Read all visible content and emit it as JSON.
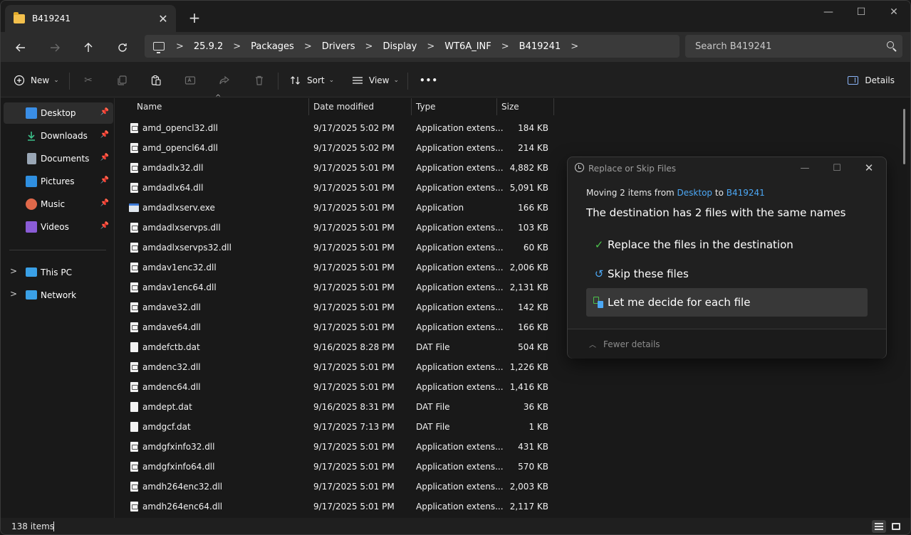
{
  "window": {
    "tab_title": "B419241",
    "tab_close": "✕",
    "new_tab": "+",
    "minimize": "—",
    "maximize": "☐",
    "close": "✕"
  },
  "address": {
    "crumbs": [
      "25.9.2",
      "Packages",
      "Drivers",
      "Display",
      "WT6A_INF",
      "B419241"
    ],
    "search_placeholder": "Search B419241"
  },
  "toolbar": {
    "new_label": "New",
    "sort_label": "Sort",
    "view_label": "View",
    "more_label": "•••",
    "details_label": "Details"
  },
  "sidebar": {
    "items": [
      {
        "label": "Desktop",
        "icon": "desktop-icon",
        "color": "#3a8ee6",
        "pinned": true,
        "selected": true
      },
      {
        "label": "Downloads",
        "icon": "downloads-icon",
        "color": "#3cc08a",
        "pinned": true
      },
      {
        "label": "Documents",
        "icon": "documents-icon",
        "color": "#9aa7b6",
        "pinned": true
      },
      {
        "label": "Pictures",
        "icon": "pictures-icon",
        "color": "#2f8fe0",
        "pinned": true
      },
      {
        "label": "Music",
        "icon": "music-icon",
        "color": "#e0684a",
        "pinned": true
      },
      {
        "label": "Videos",
        "icon": "videos-icon",
        "color": "#8a5cd6",
        "pinned": true
      },
      {
        "label": "This PC",
        "icon": "this-pc-icon",
        "color": "#3aa0e6",
        "expandable": true
      },
      {
        "label": "Network",
        "icon": "network-icon",
        "color": "#3aa0e6",
        "expandable": true
      }
    ]
  },
  "columns": {
    "name": "Name",
    "date": "Date modified",
    "type": "Type",
    "size": "Size"
  },
  "files": [
    {
      "name": "amd_opencl32.dll",
      "date": "9/17/2025 5:02 PM",
      "type": "Application extens...",
      "size": "184 KB",
      "kind": "dll"
    },
    {
      "name": "amd_opencl64.dll",
      "date": "9/17/2025 5:02 PM",
      "type": "Application extens...",
      "size": "214 KB",
      "kind": "dll"
    },
    {
      "name": "amdadlx32.dll",
      "date": "9/17/2025 5:01 PM",
      "type": "Application extens...",
      "size": "4,882 KB",
      "kind": "dll"
    },
    {
      "name": "amdadlx64.dll",
      "date": "9/17/2025 5:01 PM",
      "type": "Application extens...",
      "size": "5,091 KB",
      "kind": "dll"
    },
    {
      "name": "amdadlxserv.exe",
      "date": "9/17/2025 5:01 PM",
      "type": "Application",
      "size": "166 KB",
      "kind": "exe"
    },
    {
      "name": "amdadlxservps.dll",
      "date": "9/17/2025 5:01 PM",
      "type": "Application extens...",
      "size": "103 KB",
      "kind": "dll"
    },
    {
      "name": "amdadlxservps32.dll",
      "date": "9/17/2025 5:01 PM",
      "type": "Application extens...",
      "size": "60 KB",
      "kind": "dll"
    },
    {
      "name": "amdav1enc32.dll",
      "date": "9/17/2025 5:01 PM",
      "type": "Application extens...",
      "size": "2,006 KB",
      "kind": "dll"
    },
    {
      "name": "amdav1enc64.dll",
      "date": "9/17/2025 5:01 PM",
      "type": "Application extens...",
      "size": "2,131 KB",
      "kind": "dll"
    },
    {
      "name": "amdave32.dll",
      "date": "9/17/2025 5:01 PM",
      "type": "Application extens...",
      "size": "142 KB",
      "kind": "dll"
    },
    {
      "name": "amdave64.dll",
      "date": "9/17/2025 5:01 PM",
      "type": "Application extens...",
      "size": "166 KB",
      "kind": "dll"
    },
    {
      "name": "amdefctb.dat",
      "date": "9/16/2025 8:28 PM",
      "type": "DAT File",
      "size": "504 KB",
      "kind": "dat"
    },
    {
      "name": "amdenc32.dll",
      "date": "9/17/2025 5:01 PM",
      "type": "Application extens...",
      "size": "1,226 KB",
      "kind": "dll"
    },
    {
      "name": "amdenc64.dll",
      "date": "9/17/2025 5:01 PM",
      "type": "Application extens...",
      "size": "1,416 KB",
      "kind": "dll"
    },
    {
      "name": "amdept.dat",
      "date": "9/16/2025 8:31 PM",
      "type": "DAT File",
      "size": "36 KB",
      "kind": "dat"
    },
    {
      "name": "amdgcf.dat",
      "date": "9/17/2025 7:13 PM",
      "type": "DAT File",
      "size": "1 KB",
      "kind": "dat"
    },
    {
      "name": "amdgfxinfo32.dll",
      "date": "9/17/2025 5:01 PM",
      "type": "Application extens...",
      "size": "431 KB",
      "kind": "dll"
    },
    {
      "name": "amdgfxinfo64.dll",
      "date": "9/17/2025 5:01 PM",
      "type": "Application extens...",
      "size": "570 KB",
      "kind": "dll"
    },
    {
      "name": "amdh264enc32.dll",
      "date": "9/17/2025 5:01 PM",
      "type": "Application extens...",
      "size": "2,003 KB",
      "kind": "dll"
    },
    {
      "name": "amdh264enc64.dll",
      "date": "9/17/2025 5:01 PM",
      "type": "Application extens...",
      "size": "2,117 KB",
      "kind": "dll"
    }
  ],
  "status": {
    "item_count": "138 items"
  },
  "dialog": {
    "title": "Replace or Skip Files",
    "moving_prefix": "Moving 2 items from ",
    "moving_source": "Desktop",
    "moving_middle": " to ",
    "moving_dest": "B419241",
    "heading": "The destination has 2 files with the same names",
    "option_replace": "Replace the files in the destination",
    "option_skip": "Skip these files",
    "option_decide": "Let me decide for each file",
    "fewer_details": "Fewer details",
    "link_color": "#4ca8f5",
    "check_color": "#4cc24c"
  }
}
